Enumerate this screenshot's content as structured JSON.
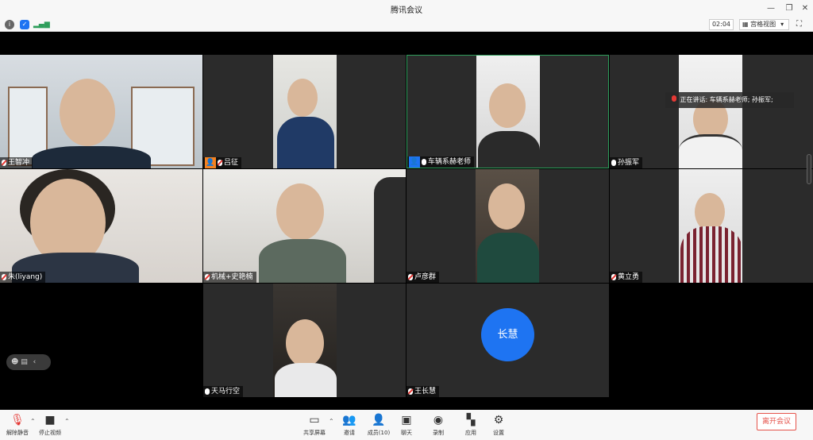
{
  "window": {
    "title": "腾讯会议"
  },
  "toolbar": {
    "timer": "02:04",
    "view_mode": "宫格视图"
  },
  "participants": {
    "p1": "王智冲",
    "p2": "吕征",
    "p3": "车辆系赫老师",
    "p4": "孙振军",
    "p5": "朱(liyang)",
    "p6": "机械+史艳楠",
    "p7": "卢彦群",
    "p8": "黄立勇",
    "p9": "天马行空",
    "p10": "王长慧"
  },
  "avatar_initials": "长慧",
  "speaking_banner": "正在讲话: 车辆系赫老师; 孙振军;",
  "bottom": {
    "unmute": "解除静音",
    "stop_video": "停止视频",
    "share_screen": "共享屏幕",
    "invite": "邀请",
    "members": "成员(10)",
    "chat": "聊天",
    "record": "录制",
    "apps": "应用",
    "settings": "设置",
    "leave": "离开会议"
  },
  "colors": {
    "accent": "#1e74f2",
    "leave": "#e5534b",
    "mute": "#e53935",
    "active_speaker_border": "#2e9e5b"
  }
}
